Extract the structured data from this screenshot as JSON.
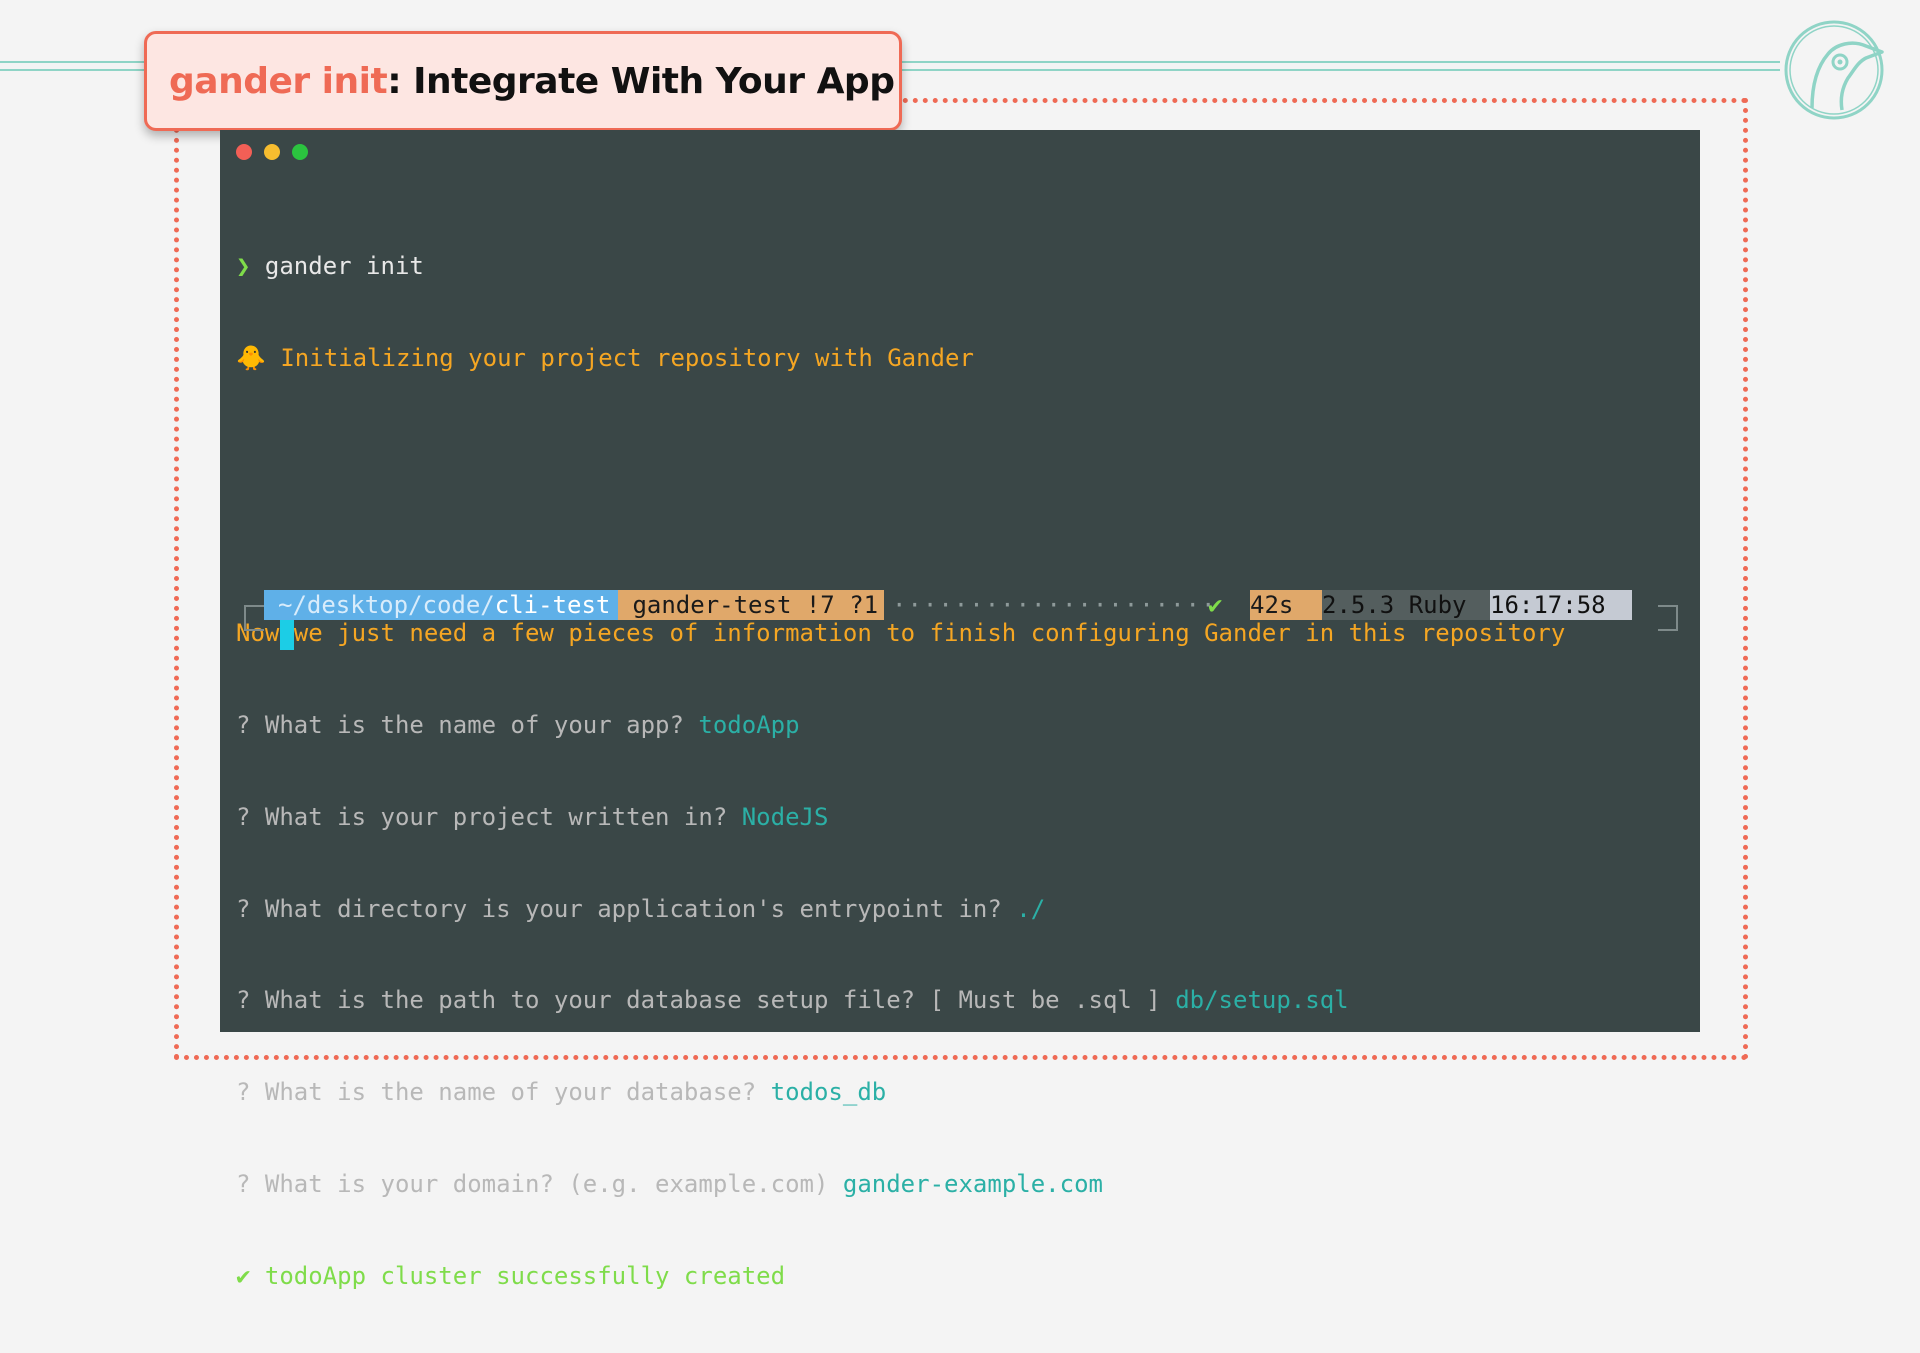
{
  "slide": {
    "title_command": "gander init",
    "title_rest": ": Integrate With Your App",
    "logo_icon": "gander-logo-icon"
  },
  "colors": {
    "accent": "#ef6a55",
    "teal": "#8fd4c6",
    "terminal_bg": "#3a4747",
    "answer": "#2bb0a6",
    "warning": "#f5a623"
  },
  "terminal": {
    "command_prompt": "❯",
    "command": "gander init",
    "init_emoji": "🐥",
    "init_message": "Initializing your project repository with Gander",
    "info_message": "Now we just need a few pieces of information to finish configuring Gander in this repository",
    "questions": [
      {
        "mark": "?",
        "question": " What is the name of your app? ",
        "answer": "todoApp"
      },
      {
        "mark": "?",
        "question": " What is your project written in? ",
        "answer": "NodeJS"
      },
      {
        "mark": "?",
        "question": " What directory is your application's entrypoint in? ",
        "answer": "./"
      },
      {
        "mark": "?",
        "question": " What is the path to your database setup file? [ Must be .sql ] ",
        "answer": "db/setup.sql"
      },
      {
        "mark": "?",
        "question": " What is the name of your database? ",
        "answer": "todos_db"
      },
      {
        "mark": "?",
        "question": " What is your domain? (e.g. example.com) ",
        "answer": "gander-example.com"
      }
    ],
    "success_mark": "✔",
    "success_message": " todoApp cluster successfully created",
    "status": {
      "path_prefix": "~/desktop/code/",
      "path_dir": "cli-test",
      "git": " gander-test !7 ?1",
      "dots": "································································",
      "check": "✔",
      "duration": "42s",
      "ruby": "2.5.3 Ruby",
      "clock": "16:17:58"
    }
  }
}
